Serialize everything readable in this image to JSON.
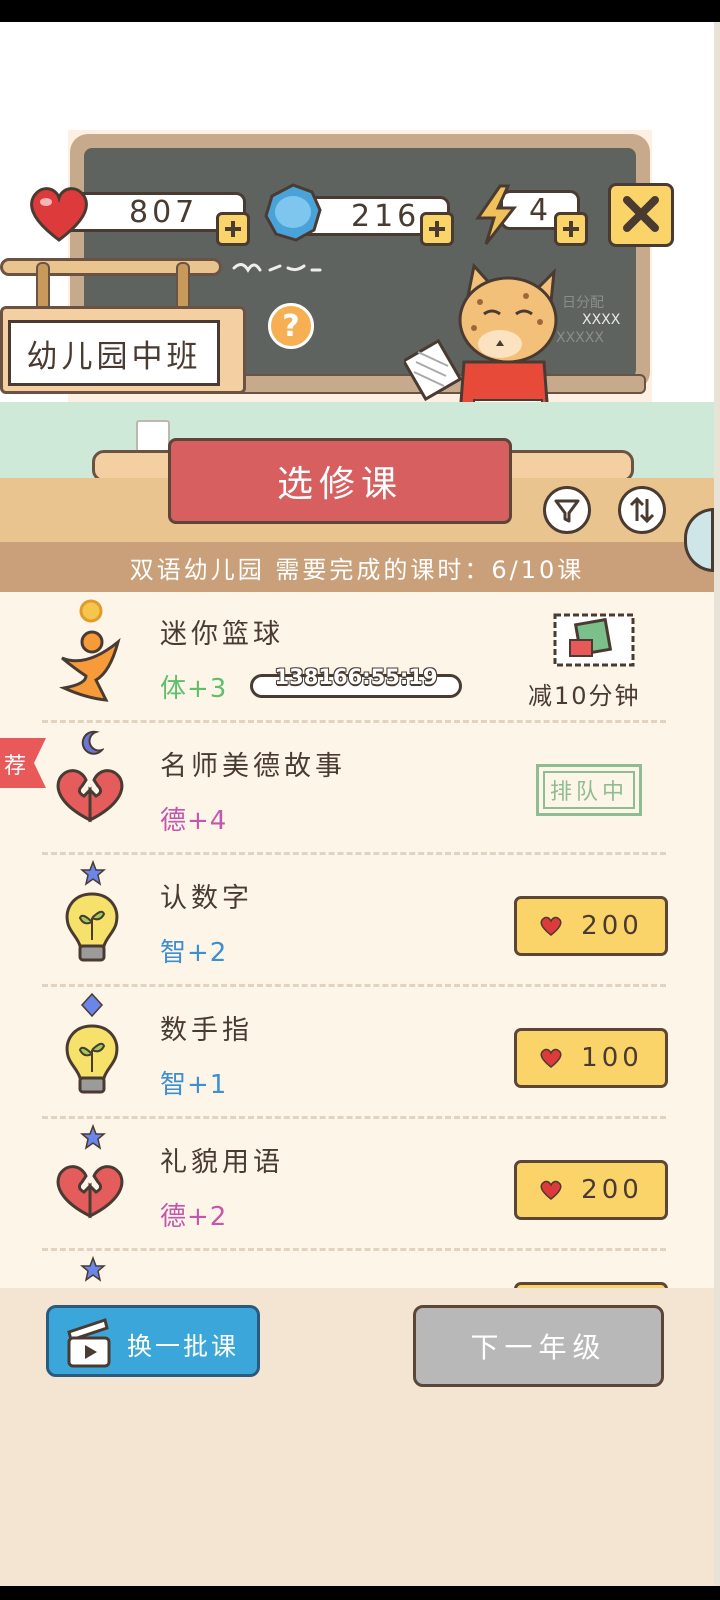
{
  "colors": {
    "accent": "#fbd469",
    "banner": "#d85f5f",
    "refresh_button": "#3ba6d9",
    "disabled_button": "#b8b8b8",
    "physical": "#5fbf6a",
    "moral": "#c457ad",
    "intellect": "#3c8fd0"
  },
  "resources": {
    "hearts": "807",
    "gems": "216",
    "energy": "4"
  },
  "class_name": "幼儿园中班",
  "help_label": "?",
  "board_text": {
    "line1": "日分配",
    "line2": "XXXX",
    "line3": "XXXXX"
  },
  "title_banner": "选修课",
  "progress_text": "双语幼儿园  需要完成的课时：6/10课",
  "recommend_badge": "荐",
  "courses": [
    {
      "name": "迷你篮球",
      "attr": "体+3",
      "icon": "runner-icon",
      "status": "timer",
      "timer": "138166:55:19",
      "action": "减10分钟"
    },
    {
      "name": "名师美德故事",
      "attr": "德+4",
      "icon": "heart-hands-icon",
      "status": "queue",
      "queue_label": "排队中"
    },
    {
      "name": "认数字",
      "attr": "智+2",
      "icon": "lightbulb-icon",
      "status": "price",
      "price": "200"
    },
    {
      "name": "数手指",
      "attr": "智+1",
      "icon": "lightbulb-icon",
      "status": "price",
      "price": "100"
    },
    {
      "name": "礼貌用语",
      "attr": "德+2",
      "icon": "heart-hands-icon",
      "status": "price",
      "price": "200"
    }
  ],
  "footer": {
    "refresh_label": "换一批课",
    "next_label": "下一年级"
  }
}
